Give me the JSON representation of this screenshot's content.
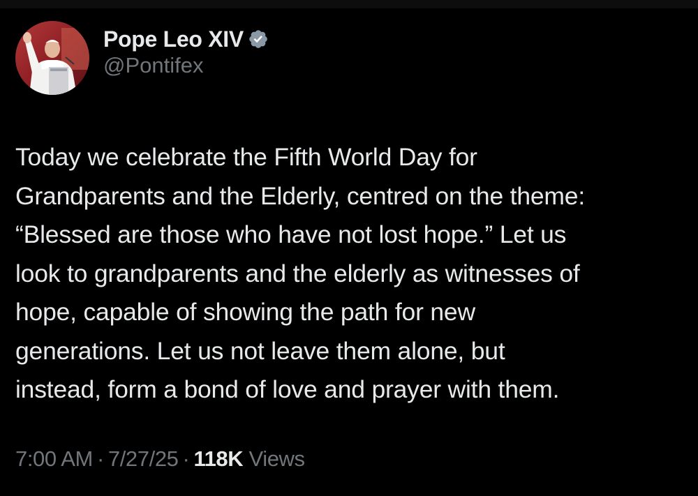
{
  "author": {
    "display_name": "Pope Leo XIV",
    "handle": "@Pontifex",
    "verified": true,
    "verified_icon": "verified-badge-icon",
    "verified_color": "#8b98a5"
  },
  "tweet": {
    "text": "Today we celebrate the Fifth World Day for\nGrandparents and the Elderly, centred on the theme:\n“Blessed are those who have not lost hope.” Let us\nlook to grandparents and the elderly as witnesses of\nhope, capable of showing the path for new\ngenerations. Let us not leave them alone, but\ninstead, form a bond of love and prayer with them."
  },
  "meta": {
    "time": "7:00 AM",
    "separator": "·",
    "date": "7/27/25",
    "views_count": "118K",
    "views_label": "Views"
  },
  "colors": {
    "background": "#000000",
    "primary_text": "#e7e9ea",
    "secondary_text": "#71767b"
  }
}
